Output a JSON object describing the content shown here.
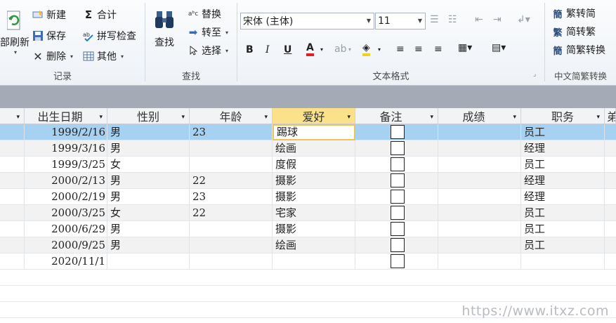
{
  "ribbon": {
    "records": {
      "refresh_label": "部刷新",
      "new_label": "新建",
      "save_label": "保存",
      "delete_label": "删除",
      "sum_label": "合计",
      "spell_label": "拼写检查",
      "other_label": "其他",
      "group_label": "记录"
    },
    "find": {
      "find_label": "查找",
      "replace_label": "替换",
      "goto_label": "转至",
      "select_label": "选择",
      "group_label": "查找"
    },
    "text_format": {
      "font_name": "宋体 (主体)",
      "font_size": "11",
      "group_label": "文本格式"
    },
    "convert": {
      "trad_to_simp": "繁转简",
      "simp_to_trad": "简转繁",
      "simp_trad_convert": "简繁转换",
      "group_label": "中文简繁转换"
    }
  },
  "table": {
    "columns": [
      "出生日期",
      "性别",
      "年龄",
      "爱好",
      "备注",
      "成绩",
      "职务",
      "弟"
    ],
    "rows": [
      {
        "birth": "1999/2/16",
        "gender": "男",
        "age": "23",
        "hobby": "踢球",
        "job": "员工"
      },
      {
        "birth": "1999/3/16",
        "gender": "男",
        "age": "",
        "hobby": "绘画",
        "job": "经理"
      },
      {
        "birth": "1999/3/25",
        "gender": "女",
        "age": "",
        "hobby": "度假",
        "job": "员工"
      },
      {
        "birth": "2000/2/13",
        "gender": "男",
        "age": "22",
        "hobby": "摄影",
        "job": "经理"
      },
      {
        "birth": "2000/2/19",
        "gender": "男",
        "age": "23",
        "hobby": "摄影",
        "job": "经理"
      },
      {
        "birth": "2000/3/25",
        "gender": "女",
        "age": "22",
        "hobby": "宅家",
        "job": "员工"
      },
      {
        "birth": "2000/6/29",
        "gender": "男",
        "age": "",
        "hobby": "摄影",
        "job": "员工"
      },
      {
        "birth": "2000/9/25",
        "gender": "男",
        "age": "",
        "hobby": "绘画",
        "job": "员工"
      },
      {
        "birth": "2020/11/1",
        "gender": "",
        "age": "",
        "hobby": "",
        "job": ""
      }
    ]
  },
  "watermark": "https://www.itxz.com",
  "colors": {
    "selected_row": "#a7d1f1",
    "active_header": "#fbe18a",
    "focus_border": "#f0c35a"
  }
}
